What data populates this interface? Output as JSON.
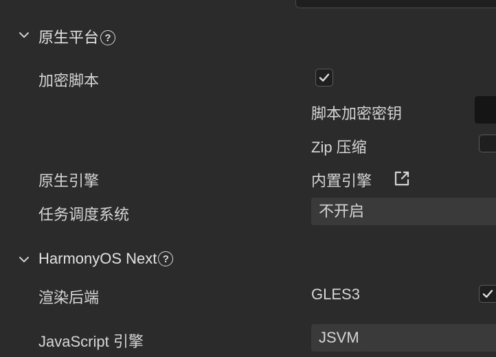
{
  "sections": {
    "native_platform": {
      "title": "原生平台",
      "help": "?"
    },
    "harmony": {
      "title": "HarmonyOS Next",
      "help": "?"
    }
  },
  "rows": {
    "encrypt_script": {
      "label": "加密脚本",
      "checked": true
    },
    "script_key": {
      "label": "脚本加密密钥",
      "value": ""
    },
    "zip_compress": {
      "label": "Zip 压缩",
      "checked": false
    },
    "native_engine": {
      "label": "原生引擎",
      "value": "内置引擎"
    },
    "task_scheduler": {
      "label": "任务调度系统",
      "value": "不开启"
    },
    "render_backend": {
      "label": "渲染后端",
      "option": "GLES3",
      "checked": true
    },
    "js_engine": {
      "label": "JavaScript 引擎",
      "value": "JSVM"
    }
  },
  "icons": {
    "chevron": "chevron-down-icon",
    "help": "help-circle-icon",
    "check": "check-icon",
    "external": "external-link-icon"
  },
  "colors": {
    "background": "#2b2b2b",
    "field": "#3a3a3a",
    "text": "#d6d6d6"
  }
}
